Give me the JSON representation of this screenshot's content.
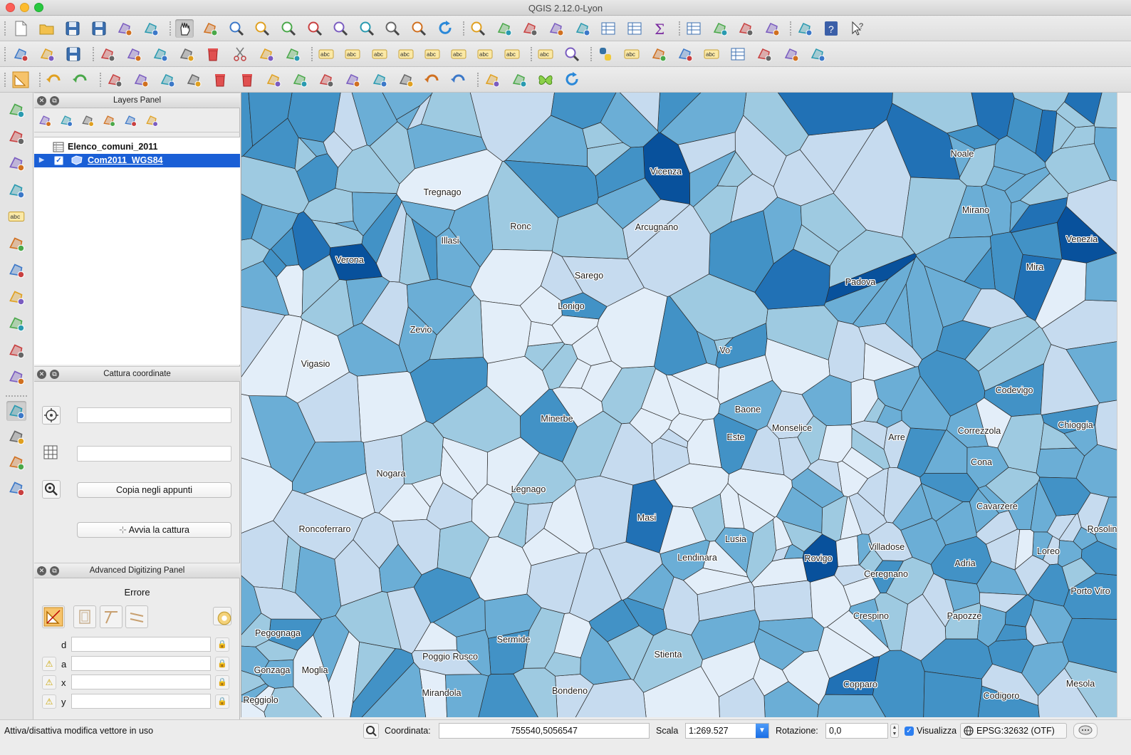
{
  "window": {
    "title": "QGIS 2.12.0-Lyon"
  },
  "colors": {
    "selection": "#1a5fd6",
    "choropleth": [
      "#e3eef9",
      "#c6dbef",
      "#9ecae1",
      "#6baed6",
      "#4292c6",
      "#2171b5",
      "#08519c",
      "#08306b"
    ]
  },
  "toolbar_icons": {
    "row1": [
      "new-project-icon",
      "open-project-icon",
      "save-project-icon",
      "save-as-icon",
      "new-print-composer-icon",
      "composer-manager-icon",
      "pan-map-icon",
      "pan-to-selection-icon",
      "zoom-in-icon",
      "zoom-out-icon",
      "zoom-native-icon",
      "zoom-full-icon",
      "zoom-to-selection-icon",
      "zoom-to-layer-icon",
      "zoom-last-icon",
      "zoom-next-icon",
      "refresh-icon",
      "identify-icon",
      "action-icon",
      "select-features-icon",
      "deselect-icon",
      "expression-select-icon",
      "attribute-table-icon",
      "statistics-icon",
      "sum-icon",
      "measure-icon",
      "map-tips-icon",
      "new-bookmark-icon",
      "show-bookmarks-icon",
      "text-annotation-icon",
      "help-icon",
      "whats-this-icon"
    ],
    "row2": [
      "current-edits-icon",
      "toggle-editing-icon",
      "save-edits-icon",
      "add-feature-icon",
      "node-tool-icon",
      "move-feature-icon",
      "digitize-icon",
      "delete-selected-icon",
      "cut-features-icon",
      "copy-features-icon",
      "paste-features-icon",
      "unpin-labels-icon",
      "label-icon",
      "label-pin-icon",
      "label-show-icon",
      "label-move-icon",
      "label-rotate-icon",
      "label-change-icon",
      "label-toggle-icon",
      "csw-icon",
      "metasearch-icon",
      "python-icon",
      "cxf-in-icon",
      "tool-icon",
      "db-manager-icon",
      "sql-icon",
      "table-icon",
      "geo-icon",
      "cloud-icon",
      "plugin-icon"
    ],
    "row3": [
      "advanced-digitize-icon",
      "undo-icon",
      "redo-icon",
      "simplify-icon",
      "add-ring-icon",
      "add-part-icon",
      "fill-ring-icon",
      "delete-ring-icon",
      "delete-part-icon",
      "reshape-icon",
      "offset-curve-icon",
      "split-features-icon",
      "split-parts-icon",
      "merge-features-icon",
      "merge-attributes-icon",
      "rotate-point-icon",
      "rotate-feature-icon",
      "snapping-icon",
      "trace-icon",
      "butterfly-icon",
      "refresh-time-icon"
    ]
  },
  "left_toolbar_icons": [
    "add-vector-layer-icon",
    "add-raster-layer-icon",
    "add-postgis-layer-icon",
    "add-spatialite-layer-icon",
    "add-mssql-layer-icon",
    "add-wms-layer-icon",
    "add-wcs-layer-icon",
    "add-wfs-layer-icon",
    "add-delimited-text-icon",
    "add-virtual-layer-icon",
    "new-layer-icon",
    "capture-coordinate-icon",
    "gps-icon",
    "sync-icon",
    "georeferencer-icon"
  ],
  "layers_panel": {
    "title": "Layers Panel",
    "tools": [
      "add-group-icon",
      "manage-visibility-icon",
      "filter-legend-icon",
      "expand-all-icon",
      "collapse-all-icon",
      "remove-layer-icon"
    ],
    "layers": [
      {
        "name": "Elenco_comuni_2011",
        "icon": "table-layer-icon",
        "selected": false
      },
      {
        "name": "Com2011_WGS84",
        "icon": "polygon-layer-icon",
        "selected": true,
        "checked": true
      }
    ]
  },
  "capture_panel": {
    "title": "Cattura coordinate",
    "field1_value": "",
    "field2_value": "",
    "copy_button": "Copia negli appunti",
    "start_button": "Avvia la cattura"
  },
  "advanced_panel": {
    "title": "Advanced Digitizing Panel",
    "error_label": "Errore",
    "rows": [
      {
        "label": "d",
        "value": ""
      },
      {
        "label": "a",
        "value": ""
      },
      {
        "label": "x",
        "value": ""
      },
      {
        "label": "y",
        "value": ""
      }
    ]
  },
  "map": {
    "labels": [
      "Tregnago",
      "Ronc",
      "Illasi",
      "Vicenza",
      "Arcugnano",
      "Noale",
      "Mirano",
      "Venezia",
      "Mira",
      "Verona",
      "Sarego",
      "Lonigo",
      "Padova",
      "Zevio",
      "Vo'",
      "Vigasio",
      "Codevigo",
      "Baone",
      "Minerbe",
      "Monselice",
      "Este",
      "Arre",
      "Correzzola",
      "Chioggia",
      "Cona",
      "Nogara",
      "Legnago",
      "Cavarzere",
      "Masi",
      "Roncoferraro",
      "Lusia",
      "Rosolina",
      "Lendinara",
      "Rovigo",
      "Villadose",
      "Loreo",
      "Adria",
      "Ceregnano",
      "Porto Viro",
      "Crespino",
      "Papozze",
      "Pegognaga",
      "Sermide",
      "Stienta",
      "Poggio Rusco",
      "Gonzaga",
      "Moglia",
      "Mirandola",
      "Bondeno",
      "Copparo",
      "Codigoro",
      "Mesola",
      "Reggiolo"
    ]
  },
  "statusbar": {
    "message": "Attiva/disattiva modifica vettore in uso",
    "coord_label": "Coordinata:",
    "coord_value": "755540,5056547",
    "scale_label": "Scala",
    "scale_value": "1:269.527",
    "rotation_label": "Rotazione:",
    "rotation_value": "0,0",
    "render_label": "Visualizza",
    "crs": "EPSG:32632 (OTF)"
  }
}
